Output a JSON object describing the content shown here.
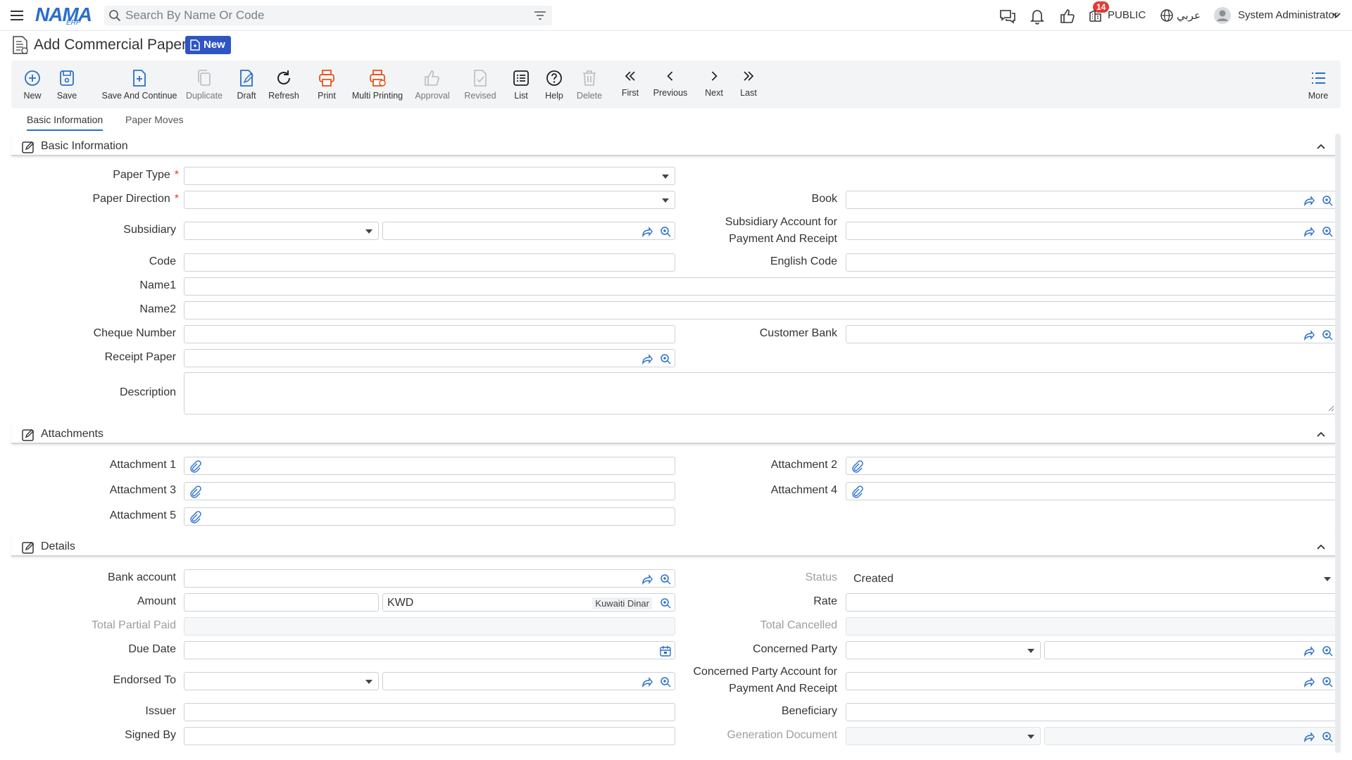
{
  "topbar": {
    "logo_text": "NAMA",
    "logo_sub": "ERP",
    "search_placeholder": "Search By Name Or Code",
    "notifications_count": "14",
    "company": "PUBLIC",
    "language": "عربي",
    "user": "System Administrator"
  },
  "page": {
    "title": "Add Commercial Paper",
    "status_badge": "New"
  },
  "toolbar": [
    {
      "label": "New",
      "icon": "plus-circle-icon"
    },
    {
      "label": "Save",
      "icon": "save-icon"
    },
    {
      "label": "Save And Continue",
      "icon": "save-continue-icon"
    },
    {
      "label": "Duplicate",
      "icon": "duplicate-icon"
    },
    {
      "label": "Draft",
      "icon": "draft-icon"
    },
    {
      "label": "Refresh",
      "icon": "refresh-icon"
    },
    {
      "label": "Print",
      "icon": "print-icon"
    },
    {
      "label": "Multi Printing",
      "icon": "multi-print-icon"
    },
    {
      "label": "Approval",
      "icon": "thumbs-up-icon"
    },
    {
      "label": "Revised",
      "icon": "revised-icon"
    },
    {
      "label": "List",
      "icon": "list-icon"
    },
    {
      "label": "Help",
      "icon": "help-icon"
    },
    {
      "label": "Delete",
      "icon": "trash-icon"
    },
    {
      "label": "First",
      "icon": "double-chevron-left-icon"
    },
    {
      "label": "Previous",
      "icon": "chevron-left-icon"
    },
    {
      "label": "Next",
      "icon": "chevron-right-icon"
    },
    {
      "label": "Last",
      "icon": "double-chevron-right-icon"
    },
    {
      "label": "More",
      "icon": "more-list-icon"
    }
  ],
  "tabs": [
    "Basic Information",
    "Paper Moves"
  ],
  "sections": {
    "basic": "Basic Information",
    "attachments": "Attachments",
    "details": "Details"
  },
  "labels": {
    "paper_type": "Paper Type",
    "paper_direction": "Paper Direction",
    "book": "Book",
    "subsidiary": "Subsidiary",
    "subsidiary_account_1": "Subsidiary Account for",
    "subsidiary_account_2": "Payment And Receipt",
    "code": "Code",
    "english_code": "English Code",
    "name1": "Name1",
    "name2": "Name2",
    "cheque_number": "Cheque Number",
    "customer_bank": "Customer Bank",
    "receipt_paper": "Receipt Paper",
    "description": "Description",
    "attachment1": "Attachment 1",
    "attachment2": "Attachment 2",
    "attachment3": "Attachment 3",
    "attachment4": "Attachment 4",
    "attachment5": "Attachment 5",
    "bank_account": "Bank account",
    "status": "Status",
    "amount": "Amount",
    "rate": "Rate",
    "total_partial_paid": "Total Partial Paid",
    "total_cancelled": "Total Cancelled",
    "due_date": "Due Date",
    "concerned_party": "Concerned Party",
    "endorsed_to": "Endorsed To",
    "concerned_party_account_1": "Concerned Party Account for",
    "concerned_party_account_2": "Payment And Receipt",
    "issuer": "Issuer",
    "beneficiary": "Beneficiary",
    "signed_by": "Signed By",
    "generation_document": "Generation Document"
  },
  "values": {
    "status": "Created",
    "currency_code": "KWD",
    "currency_name": "Kuwaiti Dinar"
  }
}
